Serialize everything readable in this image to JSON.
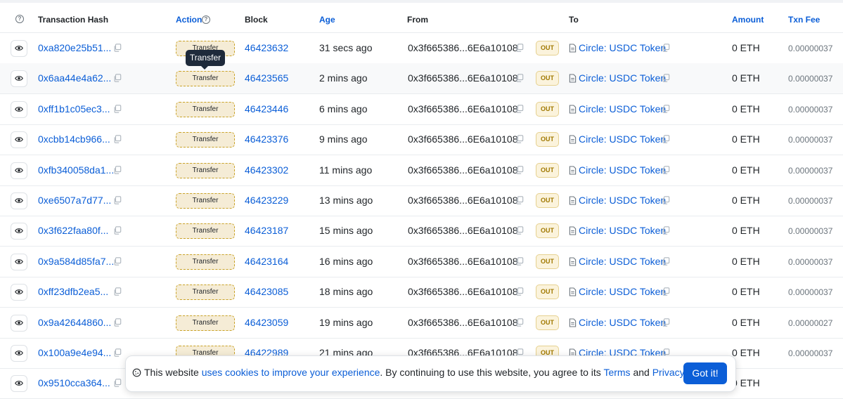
{
  "table": {
    "headers": {
      "hash": "Transaction Hash",
      "action": "Action",
      "block": "Block",
      "age": "Age",
      "from": "From",
      "to": "To",
      "amount": "Amount",
      "fee": "Txn Fee"
    },
    "rows": [
      {
        "hash": "0xa820e25b51...",
        "action": "Transfer",
        "block": "46423632",
        "age": "31 secs ago",
        "from": "0x3f665386...6E6a10108",
        "direction": "OUT",
        "to": "Circle: USDC Token",
        "amount": "0 ETH",
        "fee": "0.00000037"
      },
      {
        "hash": "0x6aa44e4a62...",
        "action": "Transfer",
        "block": "46423565",
        "age": "2 mins ago",
        "from": "0x3f665386...6E6a10108",
        "direction": "OUT",
        "to": "Circle: USDC Token",
        "amount": "0 ETH",
        "fee": "0.00000037"
      },
      {
        "hash": "0xff1b1c05ec3...",
        "action": "Transfer",
        "block": "46423446",
        "age": "6 mins ago",
        "from": "0x3f665386...6E6a10108",
        "direction": "OUT",
        "to": "Circle: USDC Token",
        "amount": "0 ETH",
        "fee": "0.00000037"
      },
      {
        "hash": "0xcbb14cb966...",
        "action": "Transfer",
        "block": "46423376",
        "age": "9 mins ago",
        "from": "0x3f665386...6E6a10108",
        "direction": "OUT",
        "to": "Circle: USDC Token",
        "amount": "0 ETH",
        "fee": "0.00000037"
      },
      {
        "hash": "0xfb340058da1...",
        "action": "Transfer",
        "block": "46423302",
        "age": "11 mins ago",
        "from": "0x3f665386...6E6a10108",
        "direction": "OUT",
        "to": "Circle: USDC Token",
        "amount": "0 ETH",
        "fee": "0.00000037"
      },
      {
        "hash": "0xe6507a7d77...",
        "action": "Transfer",
        "block": "46423229",
        "age": "13 mins ago",
        "from": "0x3f665386...6E6a10108",
        "direction": "OUT",
        "to": "Circle: USDC Token",
        "amount": "0 ETH",
        "fee": "0.00000037"
      },
      {
        "hash": "0x3f622faa80f...",
        "action": "Transfer",
        "block": "46423187",
        "age": "15 mins ago",
        "from": "0x3f665386...6E6a10108",
        "direction": "OUT",
        "to": "Circle: USDC Token",
        "amount": "0 ETH",
        "fee": "0.00000037"
      },
      {
        "hash": "0x9a584d85fa7...",
        "action": "Transfer",
        "block": "46423164",
        "age": "16 mins ago",
        "from": "0x3f665386...6E6a10108",
        "direction": "OUT",
        "to": "Circle: USDC Token",
        "amount": "0 ETH",
        "fee": "0.00000037"
      },
      {
        "hash": "0xff23dfb2ea5...",
        "action": "Transfer",
        "block": "46423085",
        "age": "18 mins ago",
        "from": "0x3f665386...6E6a10108",
        "direction": "OUT",
        "to": "Circle: USDC Token",
        "amount": "0 ETH",
        "fee": "0.00000037"
      },
      {
        "hash": "0x9a42644860...",
        "action": "Transfer",
        "block": "46423059",
        "age": "19 mins ago",
        "from": "0x3f665386...6E6a10108",
        "direction": "OUT",
        "to": "Circle: USDC Token",
        "amount": "0 ETH",
        "fee": "0.00000027"
      },
      {
        "hash": "0x100a9e4e94...",
        "action": "Transfer",
        "block": "46422989",
        "age": "21 mins ago",
        "from": "0x3f665386...6E6a10108",
        "direction": "OUT",
        "to": "Circle: USDC Token",
        "amount": "0 ETH",
        "fee": "0.00000037"
      },
      {
        "hash": "0x9510cca364...",
        "action": "Transfer",
        "block": "",
        "age": "",
        "from": "",
        "direction": "",
        "to": "",
        "amount": "0 ETH",
        "fee": ""
      }
    ]
  },
  "tooltip": {
    "text": "Transfer"
  },
  "cookie": {
    "text_before": "This website ",
    "link_text": "uses cookies to improve your experience",
    "text_middle": ". By continuing to use this website, you agree to its ",
    "terms": "Terms",
    "and": " and ",
    "privacy": "Privacy Policy",
    "end": ".",
    "button": "Got it!"
  },
  "icons": {
    "view": "eye-icon",
    "copy": "copy-icon",
    "contract": "document-icon",
    "help": "question-circle-icon",
    "cookie": "cookie-icon"
  }
}
